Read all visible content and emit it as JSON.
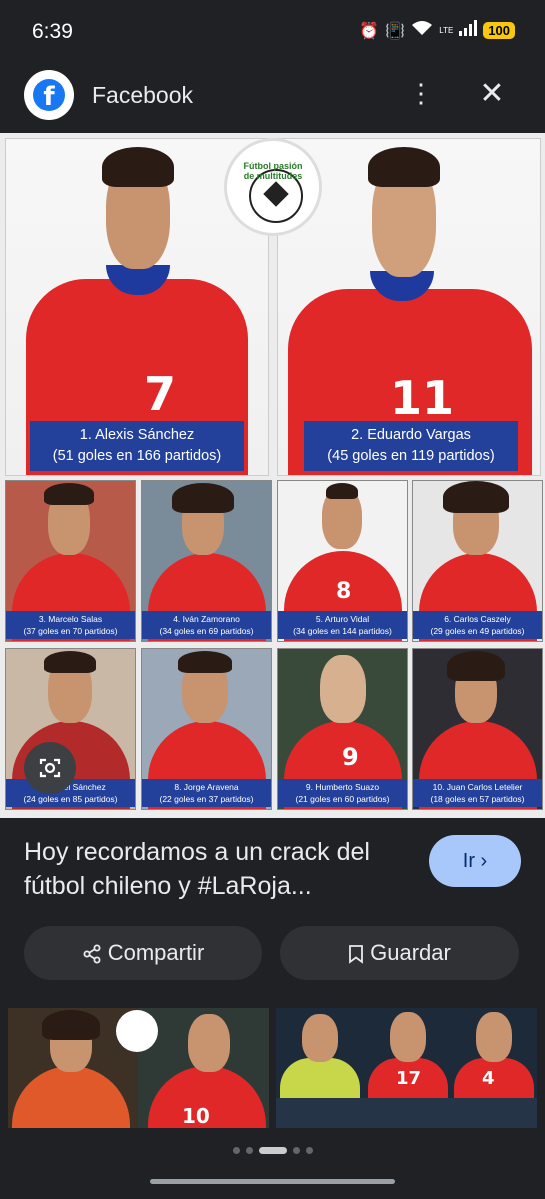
{
  "status": {
    "time": "6:39",
    "battery": "100",
    "net": "LTE"
  },
  "source": {
    "name": "Facebook",
    "icon": "facebook-icon"
  },
  "image": {
    "logo_text": "Fútbol pasión de multitudes",
    "players": [
      {
        "line1": "1. Alexis Sánchez",
        "line2": "(51 goles en 166 partidos)",
        "number": "7"
      },
      {
        "line1": "2. Eduardo Vargas",
        "line2": "(45 goles en 119 partidos)",
        "number": "11"
      },
      {
        "line1": "3. Marcelo Salas",
        "line2": "(37 goles en 70 partidos)"
      },
      {
        "line1": "4. Iván Zamorano",
        "line2": "(34 goles en 69 partidos)"
      },
      {
        "line1": "5. Arturo Vidal",
        "line2": "(34 goles en 144 partidos)",
        "number": "8"
      },
      {
        "line1": "6. Carlos Caszely",
        "line2": "(29 goles en 49 partidos)"
      },
      {
        "line1": "7. Leonel Sánchez",
        "line2": "(24 goles en 85 partidos)"
      },
      {
        "line1": "8. Jorge Aravena",
        "line2": "(22 goles en 37 partidos)"
      },
      {
        "line1": "9. Humberto Suazo",
        "line2": "(21 goles en 60 partidos)",
        "number": "9"
      },
      {
        "line1": "10. Juan Carlos Letelier",
        "line2": "(18 goles en 57 partidos)"
      }
    ]
  },
  "caption": "Hoy recordamos a un crack del fútbol chileno y #LaRoja...",
  "actions": {
    "go": "Ir",
    "share": "Compartir",
    "save": "Guardar"
  },
  "related": {
    "numbers": [
      "10",
      "17",
      "4"
    ]
  },
  "colors": {
    "accent": "#a8c7fa",
    "jersey": "#e02828",
    "caption_band": "#23409a"
  }
}
